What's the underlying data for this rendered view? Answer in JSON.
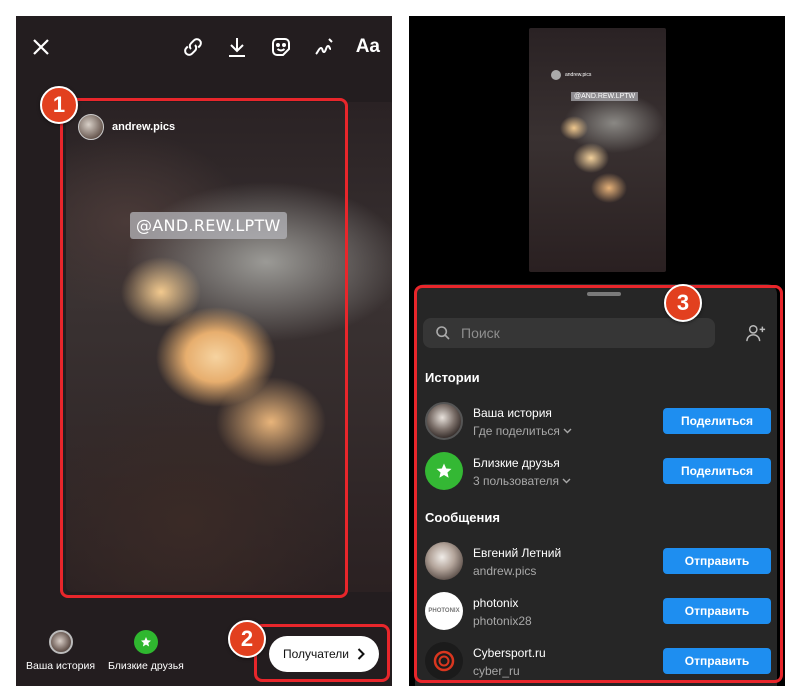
{
  "annotations": {
    "badge1": "1",
    "badge2": "2",
    "badge3": "3"
  },
  "editor": {
    "story_username": "andrew.pics",
    "mention_sticker": "@AND.REW.LPTW",
    "text_tool_label": "Aa",
    "toolbar_icons": [
      "close-icon",
      "link-icon",
      "download-icon",
      "sticker-icon",
      "draw-icon"
    ],
    "share_options": [
      {
        "label": "Ваша история"
      },
      {
        "label": "Близкие друзья"
      }
    ],
    "recipients_button": "Получатели"
  },
  "share_sheet": {
    "preview": {
      "username": "andrew.pics",
      "mention": "@AND.REW.LPTW"
    },
    "search_placeholder": "Поиск",
    "stories_title": "Истории",
    "stories": [
      {
        "name": "Ваша история",
        "sub": "Где поделиться",
        "button": "Поделиться"
      },
      {
        "name": "Близкие друзья",
        "sub": "3 пользователя",
        "button": "Поделиться"
      }
    ],
    "messages_title": "Сообщения",
    "messages": [
      {
        "name": "Евгений Летний",
        "sub": "andrew.pics",
        "button": "Отправить"
      },
      {
        "name": "photonix",
        "sub": "photonix28",
        "button": "Отправить",
        "avatar_text": "PHOTONIX"
      },
      {
        "name": "Cybersport.ru",
        "sub": "cyber_ru",
        "button": "Отправить"
      }
    ]
  },
  "colors": {
    "accent_red": "#e8262b",
    "badge": "#e2401f",
    "button_blue": "#1e8ef0",
    "friends_green": "#2fb72f"
  }
}
